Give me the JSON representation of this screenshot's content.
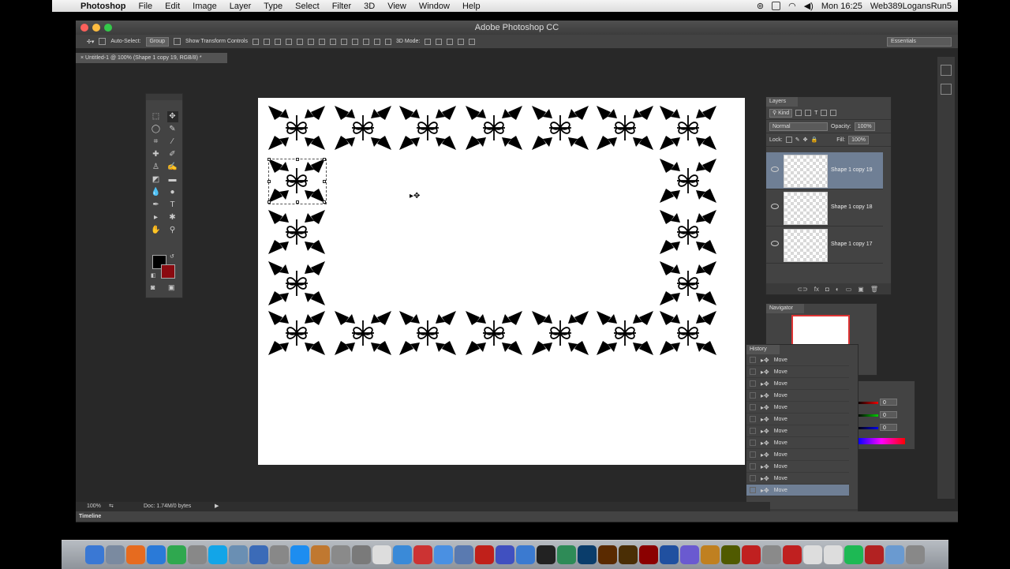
{
  "menubar": {
    "app": "Photoshop",
    "items": [
      "File",
      "Edit",
      "Image",
      "Layer",
      "Type",
      "Select",
      "Filter",
      "3D",
      "View",
      "Window",
      "Help"
    ],
    "clock": "Mon 16:25",
    "user": "Web389LogansRun5"
  },
  "window": {
    "title": "Adobe Photoshop CC",
    "doc_tab": "Untitled-1 @ 100% (Shape 1 copy 19, RGB/8) *"
  },
  "options": {
    "auto_select": "Auto-Select:",
    "group": "Group",
    "show_transform": "Show Transform Controls",
    "mode3d": "3D Mode:",
    "workspace": "Essentials"
  },
  "layers_panel": {
    "tab": "Layers",
    "kind": "Kind",
    "blend": "Normal",
    "opacity_label": "Opacity:",
    "opacity": "100%",
    "lock_label": "Lock:",
    "fill_label": "Fill:",
    "fill": "100%",
    "layers": [
      {
        "name": "Shape 1 copy 19",
        "selected": true
      },
      {
        "name": "Shape 1 copy 18",
        "selected": false
      },
      {
        "name": "Shape 1 copy 17",
        "selected": false
      }
    ]
  },
  "navigator": {
    "tab": "Navigator"
  },
  "color_panel": {
    "r": "0",
    "g": "0",
    "b": "0"
  },
  "history": {
    "tab": "History",
    "items": [
      "Move",
      "Move",
      "Move",
      "Move",
      "Move",
      "Move",
      "Move",
      "Move",
      "Move",
      "Move",
      "Move",
      "Move"
    ],
    "selected_index": 11
  },
  "status": {
    "zoom": "100%",
    "doc": "Doc: 1.74M/0 bytes"
  },
  "timeline": {
    "label": "Timeline"
  },
  "colors": {
    "fg": "#000000",
    "bg": "#8a0a10",
    "selection": "#6f7f95"
  },
  "dock": [
    "Finder",
    "Launchpad",
    "Firefox",
    "Safari",
    "Chrome",
    "Photo Booth",
    "Skype",
    "Preview",
    "Xcode",
    "Sys Prefs",
    "App Store",
    "Garage",
    "Tools",
    "Script",
    "Doc",
    "Safari2",
    "Camera",
    "Mail",
    "Pencil",
    "Acrobat",
    "Snow",
    "iTunes",
    "Kindle",
    "Dw",
    "Ps",
    "Ai",
    "Br",
    "Flash",
    "Edge",
    "Brush",
    "Paint",
    "Fw",
    "Book",
    "Preview2",
    "Acrobat2",
    "TextEdit",
    "Pages",
    "Spotify",
    "Filezilla",
    "Folder",
    "Trash"
  ]
}
